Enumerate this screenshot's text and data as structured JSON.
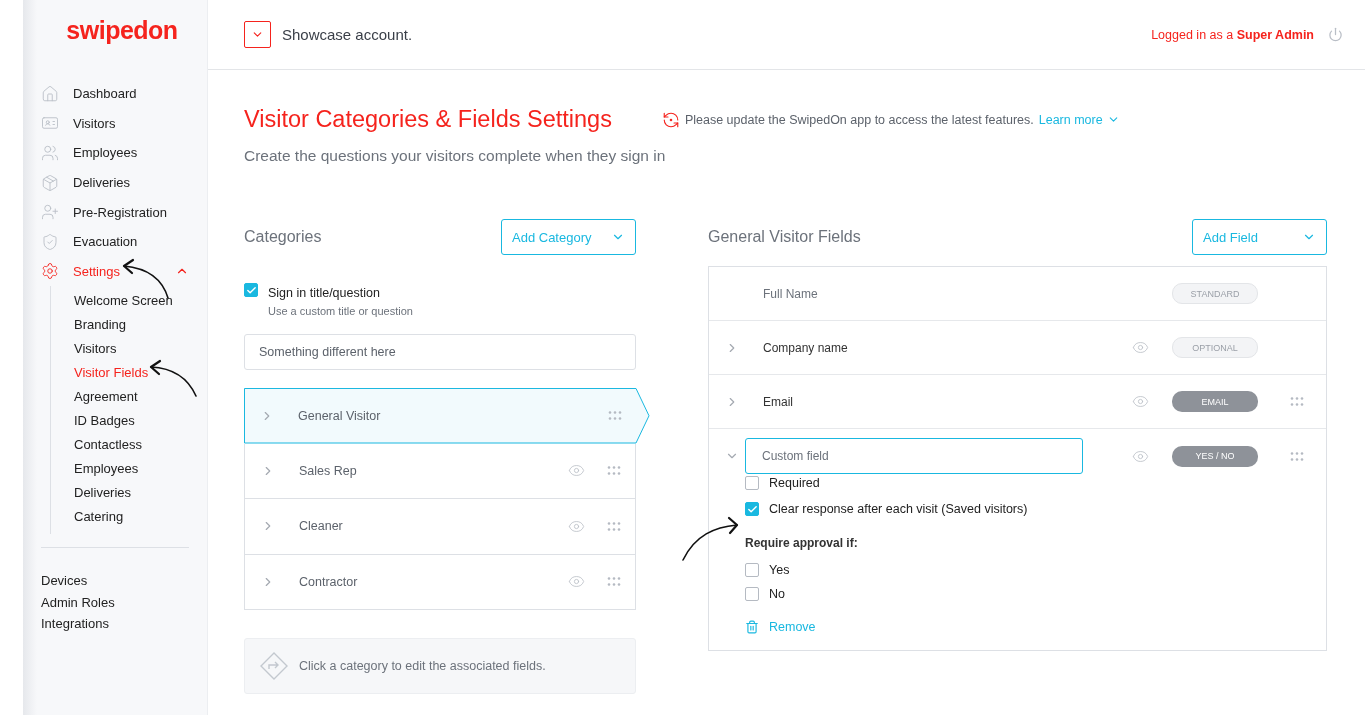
{
  "sidebar": {
    "logo": "swipedon",
    "nav": [
      {
        "label": "Dashboard",
        "selected": false
      },
      {
        "label": "Visitors",
        "selected": false
      },
      {
        "label": "Employees",
        "selected": false
      },
      {
        "label": "Deliveries",
        "selected": false
      },
      {
        "label": "Pre-Registration",
        "selected": false
      },
      {
        "label": "Evacuation",
        "selected": false
      },
      {
        "label": "Settings",
        "selected": true,
        "expanded": true,
        "children": [
          {
            "label": "Welcome Screen",
            "selected": false
          },
          {
            "label": "Branding",
            "selected": false
          },
          {
            "label": "Visitors",
            "selected": false
          },
          {
            "label": "Visitor Fields",
            "selected": true
          },
          {
            "label": "Agreement",
            "selected": false
          },
          {
            "label": "ID Badges",
            "selected": false
          },
          {
            "label": "Contactless",
            "selected": false
          },
          {
            "label": "Employees",
            "selected": false
          },
          {
            "label": "Deliveries",
            "selected": false
          },
          {
            "label": "Catering",
            "selected": false
          }
        ]
      }
    ],
    "bottom_links": [
      "Devices",
      "Admin Roles",
      "Integrations"
    ]
  },
  "topbar": {
    "account": "Showcase account.",
    "login_prefix": "Logged in as a ",
    "login_role": "Super Admin"
  },
  "page": {
    "title": "Visitor Categories & Fields Settings",
    "notice": "Please update the SwipedOn app to access the latest features.",
    "notice_link": "Learn more",
    "subtitle": "Create the questions your visitors complete when they sign in"
  },
  "categories": {
    "heading": "Categories",
    "add_button": "Add Category",
    "sign_in_title": {
      "label": "Sign in title/question",
      "hint": "Use a custom title or question",
      "checked": true,
      "value": "Something different here"
    },
    "items": [
      {
        "label": "General Visitor",
        "selected": true
      },
      {
        "label": "Sales Rep",
        "selected": false
      },
      {
        "label": "Cleaner",
        "selected": false
      },
      {
        "label": "Contractor",
        "selected": false
      }
    ],
    "hint": "Click a category to edit the associated fields."
  },
  "fields": {
    "heading": "General Visitor Fields",
    "add_button": "Add Field",
    "rows": [
      {
        "label": "Full Name",
        "kind": "fixed",
        "badge": "STANDARD",
        "badge_filled": false,
        "draggable": false
      },
      {
        "label": "Company name",
        "kind": "collapsed",
        "badge": "OPTIONAL",
        "badge_filled": false,
        "draggable": false
      },
      {
        "label": "Email",
        "kind": "collapsed",
        "badge": "EMAIL",
        "badge_filled": true,
        "draggable": true
      },
      {
        "label": "Custom field",
        "kind": "editing",
        "badge": "YES / NO",
        "badge_filled": true,
        "draggable": true
      }
    ],
    "options": [
      {
        "label": "Required",
        "checked": false
      },
      {
        "label": "Clear response after each visit (Saved visitors)",
        "checked": true
      }
    ],
    "approval_heading": "Require approval if:",
    "approval": [
      {
        "label": "Yes",
        "checked": false
      },
      {
        "label": "No",
        "checked": false
      }
    ],
    "remove": "Remove"
  }
}
